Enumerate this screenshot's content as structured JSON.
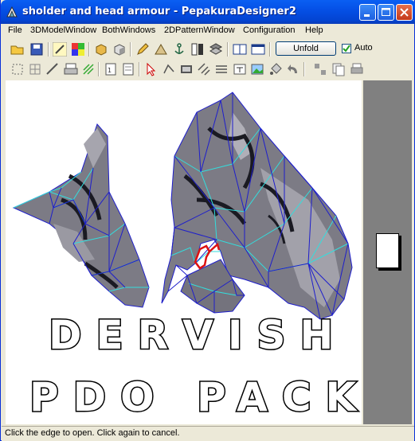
{
  "window": {
    "title": "sholder and head armour - PepakuraDesigner2"
  },
  "menu": {
    "items": [
      "File",
      "3DModelWindow",
      "BothWindows",
      "2DPatternWindow",
      "Configuration",
      "Help"
    ]
  },
  "toolbar": {
    "unfold_label": "Unfold",
    "auto_label": "Auto",
    "auto_checked": true
  },
  "overlay": {
    "line1": "DERVISH",
    "line2": "PDO PACK"
  },
  "status": {
    "text": "Click the edge to open. Click again to cancel."
  },
  "colors": {
    "titlebar": "#0550e6",
    "mesh_edge": "#1e1ecc",
    "mesh_fold": "#33dddd",
    "cut_edge": "#dd1111",
    "model_fill": "#7c7b85"
  }
}
